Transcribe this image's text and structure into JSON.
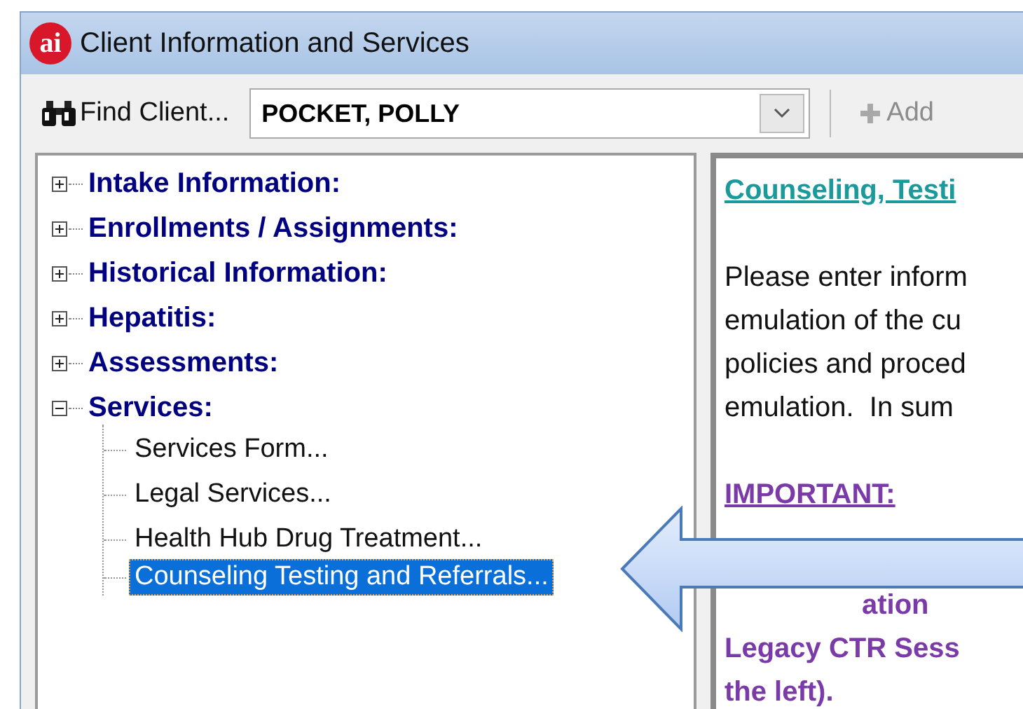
{
  "window": {
    "title": "Client Information and Services",
    "logo_text": "ai"
  },
  "toolbar": {
    "find_label": "Find Client...",
    "client": "POCKET, POLLY",
    "add_label": "Add",
    "add_disabled": true
  },
  "tree": [
    {
      "label": "Intake Information:",
      "expanded": false
    },
    {
      "label": "Enrollments / Assignments:",
      "expanded": false
    },
    {
      "label": "Historical Information:",
      "expanded": false
    },
    {
      "label": "Hepatitis:",
      "expanded": false
    },
    {
      "label": "Assessments:",
      "expanded": false
    },
    {
      "label": "Services:",
      "expanded": true,
      "children": [
        {
          "label": "Services Form...",
          "selected": false
        },
        {
          "label": "Legal Services...",
          "selected": false
        },
        {
          "label": "Health Hub Drug Treatment...",
          "selected": false
        },
        {
          "label": "Counseling Testing and Referrals...",
          "selected": true
        }
      ]
    }
  ],
  "content": {
    "heading": "Counseling, Testi",
    "paragraph": [
      "Please enter inform",
      "emulation of the cu",
      "policies and proced",
      "emulation.  In sum"
    ],
    "important_heading": "IMPORTANT:",
    "important_lines": [
      "ation",
      "Legacy CTR Sess",
      "the left)."
    ]
  }
}
